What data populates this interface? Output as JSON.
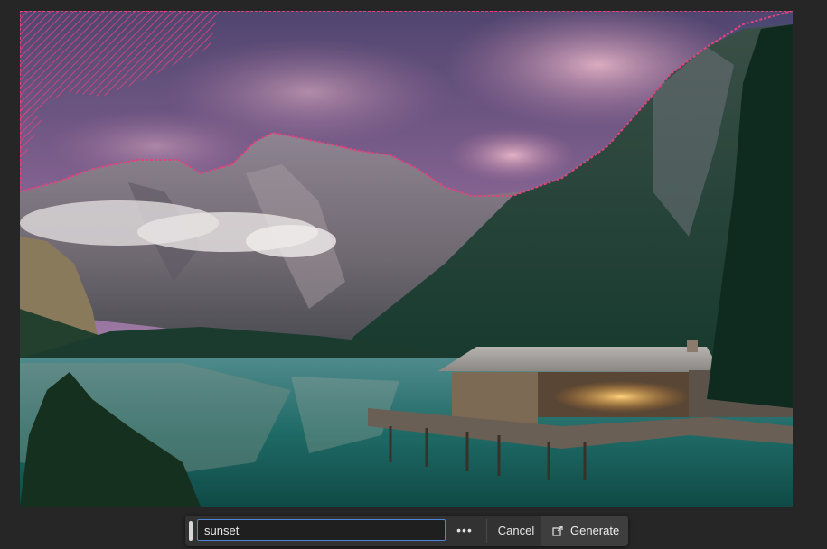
{
  "canvas": {
    "image_subject": "mountain-lake-landscape-with-boathouse",
    "selection_color": "#e0447f"
  },
  "generative_bar": {
    "prompt_value": "sunset",
    "more_icon": "ellipsis-icon",
    "cancel_label": "Cancel",
    "generate_label": "Generate",
    "generate_icon": "generate-icon",
    "accent": "#4b87d8"
  }
}
